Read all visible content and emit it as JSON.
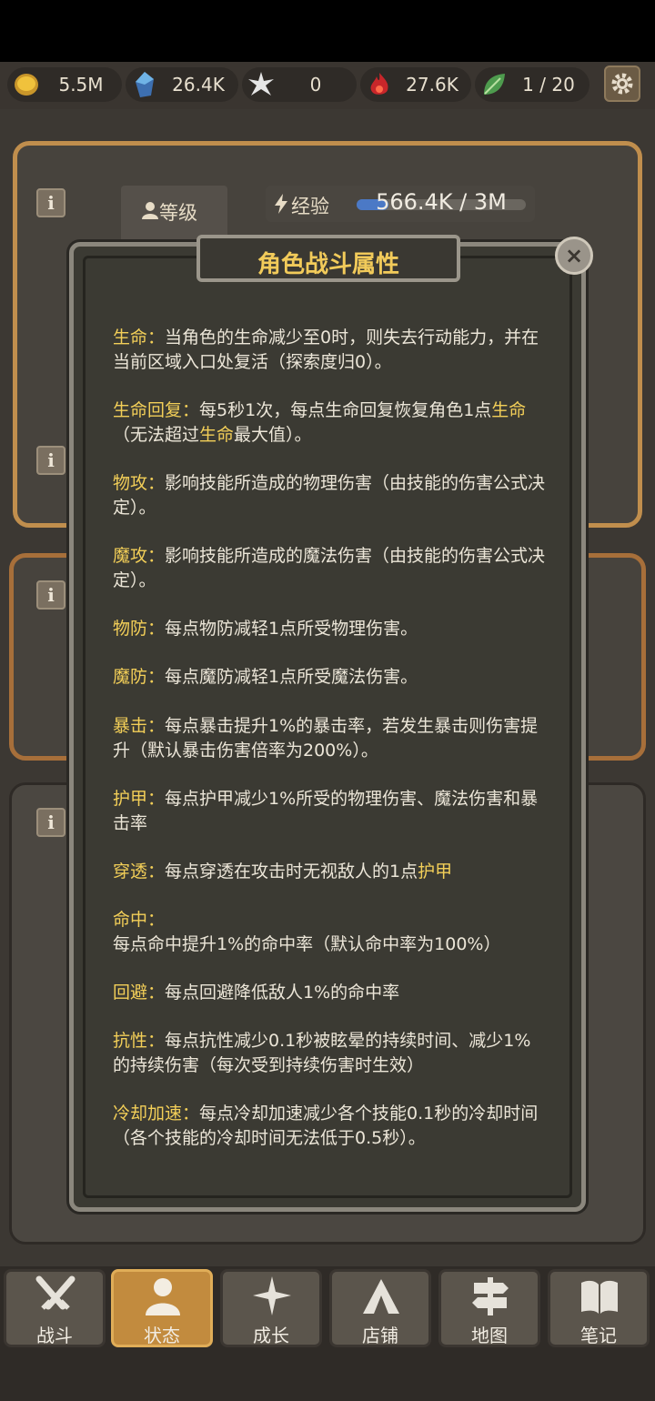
{
  "resources": [
    {
      "icon": "gold-coin-icon",
      "value": "5.5M"
    },
    {
      "icon": "blue-crystal-icon",
      "value": "26.4K"
    },
    {
      "icon": "star-burst-icon",
      "value": "0"
    },
    {
      "icon": "red-flame-icon",
      "value": "27.6K"
    },
    {
      "icon": "green-leaf-icon",
      "value": "1 / 20"
    }
  ],
  "status": {
    "level_label": "等级",
    "exp_label": "经验",
    "exp_text": "566.4K / 3M",
    "exp_progress": 0.19
  },
  "dialog": {
    "title": "角色战斗属性",
    "close_label": "×",
    "entries": [
      {
        "key": "生命：",
        "segments": [
          {
            "t": "当角色的生命减少至0时，则失去行动能力，并在当前区域入口处复活（探索度归0）。"
          }
        ]
      },
      {
        "key": "生命回复：",
        "segments": [
          {
            "t": "每5秒1次，每点生命回复恢复角色1点"
          },
          {
            "t": "生命",
            "hl": true
          },
          {
            "t": "（无法超过"
          },
          {
            "t": "生命",
            "hl": true
          },
          {
            "t": "最大值）。"
          }
        ]
      },
      {
        "key": "物攻：",
        "segments": [
          {
            "t": "影响技能所造成的物理伤害（由技能的伤害公式决定）。"
          }
        ]
      },
      {
        "key": "魔攻：",
        "segments": [
          {
            "t": "影响技能所造成的魔法伤害（由技能的伤害公式决定）。"
          }
        ]
      },
      {
        "key": "物防：",
        "segments": [
          {
            "t": "每点物防减轻1点所受物理伤害。"
          }
        ]
      },
      {
        "key": "魔防：",
        "segments": [
          {
            "t": "每点魔防减轻1点所受魔法伤害。"
          }
        ]
      },
      {
        "key": "暴击：",
        "segments": [
          {
            "t": "每点暴击提升1%的暴击率，若发生暴击则伤害提升（默认暴击伤害倍率为200%）。"
          }
        ]
      },
      {
        "key": "护甲：",
        "segments": [
          {
            "t": "每点护甲减少1%所受的物理伤害、魔法伤害和暴击率"
          }
        ]
      },
      {
        "key": "穿透：",
        "segments": [
          {
            "t": "每点穿透在攻击时无视敌人的1点"
          },
          {
            "t": "护甲",
            "hl": true
          }
        ]
      },
      {
        "key": "命中：",
        "segments": [
          {
            "t": "每点命中提升1%的命中率（默认命中率为100%）"
          }
        ]
      },
      {
        "key": "回避：",
        "segments": [
          {
            "t": "每点回避降低敌人1%的命中率"
          }
        ]
      },
      {
        "key": "抗性：",
        "segments": [
          {
            "t": "每点抗性减少0.1秒被眩晕的持续时间、减少1%的持续伤害（每次受到持续伤害时生效）"
          }
        ]
      },
      {
        "key": "冷却加速：",
        "segments": [
          {
            "t": "每点冷却加速减少各个技能0.1秒的冷却时间（各个技能的冷却时间无法低于0.5秒）。"
          }
        ]
      }
    ]
  },
  "tabs": [
    {
      "label": "战斗",
      "icon": "crossed-swords-icon",
      "active": false
    },
    {
      "label": "状态",
      "icon": "person-icon",
      "active": true
    },
    {
      "label": "成长",
      "icon": "sparkle-icon",
      "active": false
    },
    {
      "label": "店铺",
      "icon": "tent-icon",
      "active": false
    },
    {
      "label": "地图",
      "icon": "signpost-icon",
      "active": false
    },
    {
      "label": "笔记",
      "icon": "book-icon",
      "active": false
    }
  ]
}
